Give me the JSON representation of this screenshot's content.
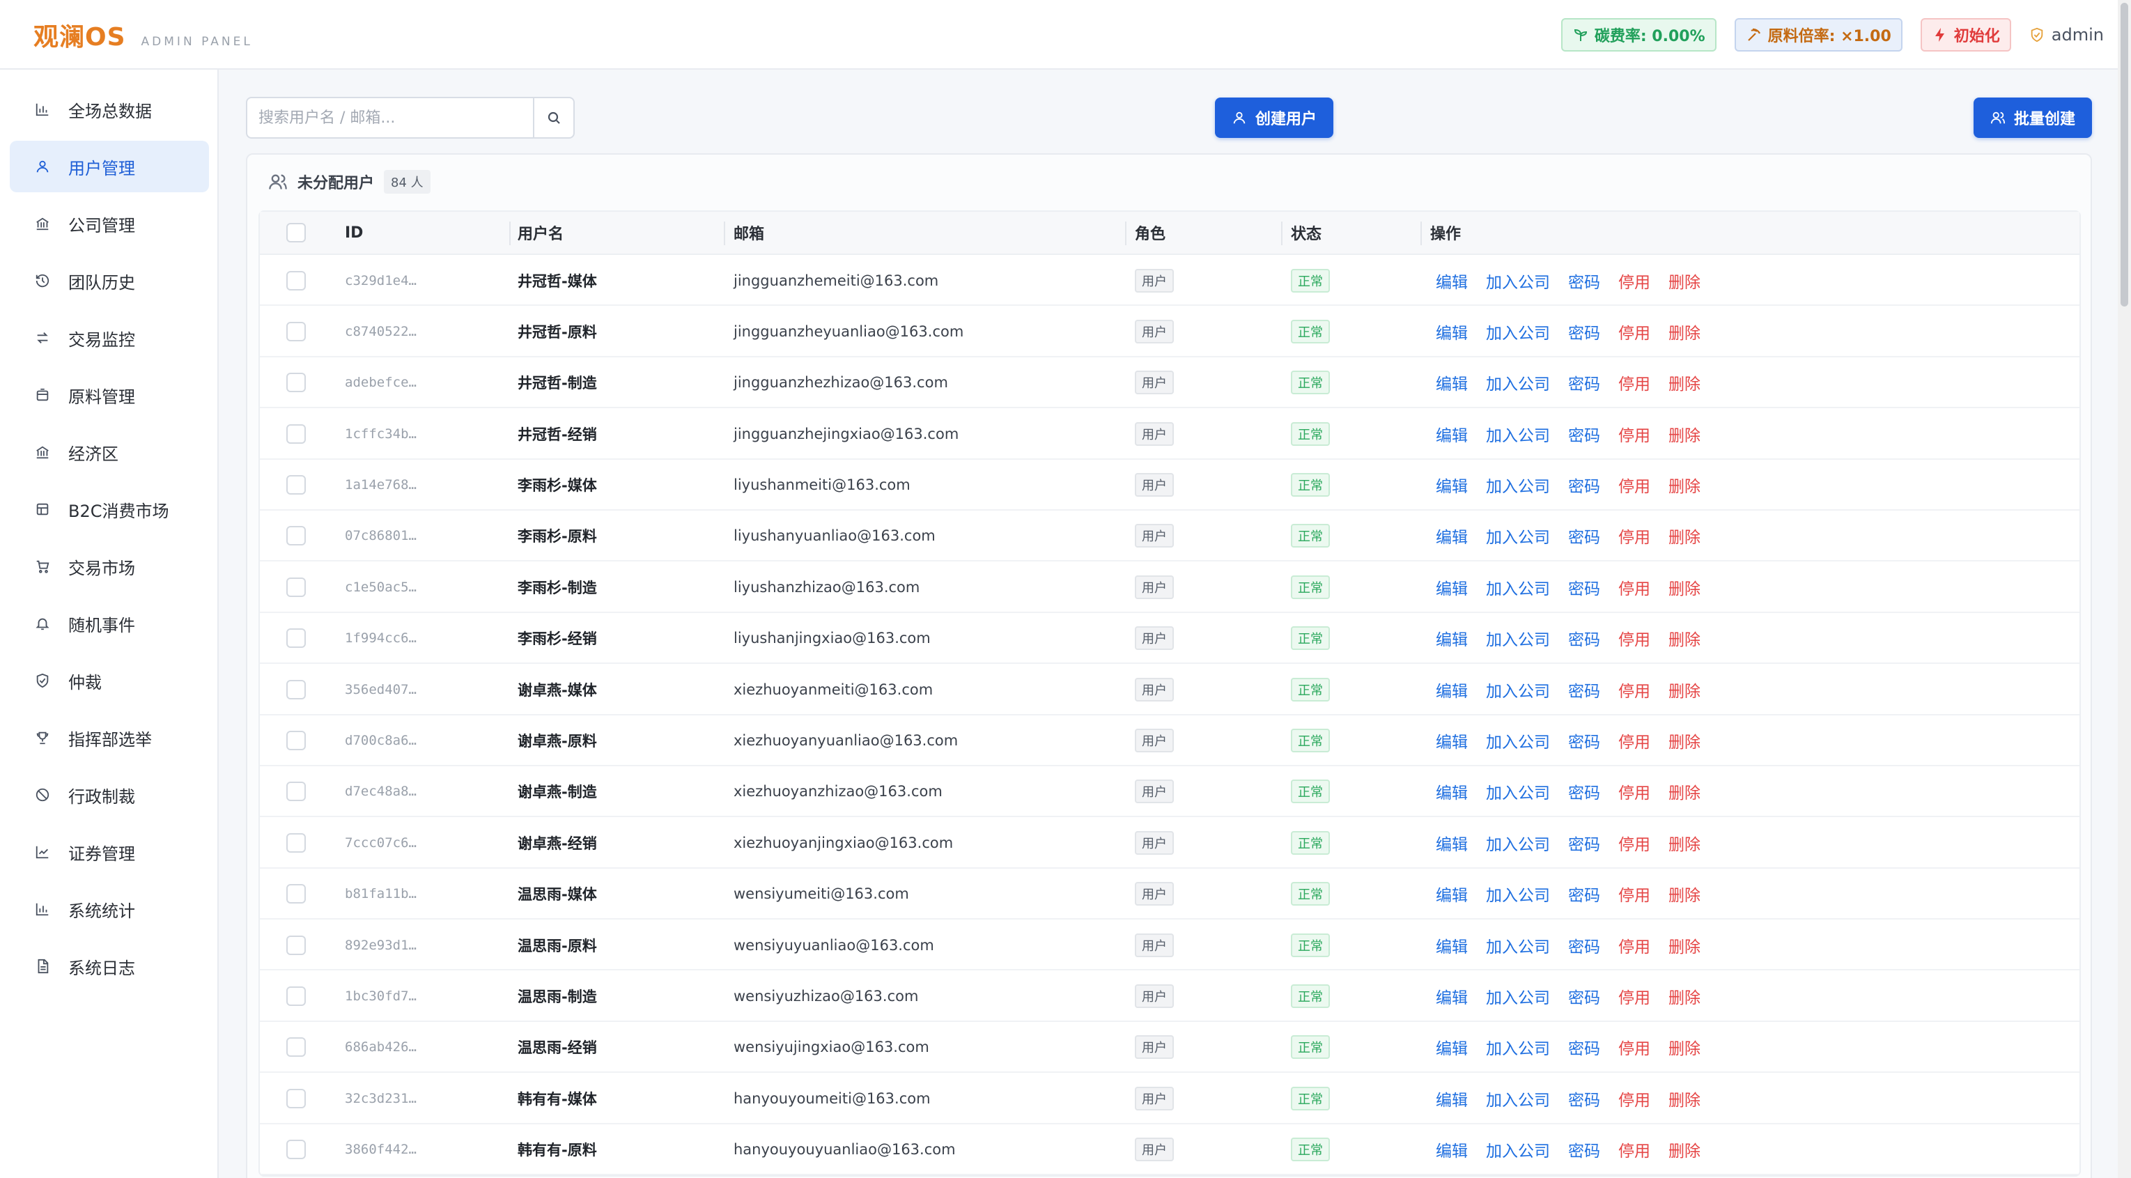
{
  "header": {
    "brand": "观澜OS",
    "subtitle": "ADMIN PANEL",
    "carbon": "碳费率: 0.00%",
    "material": "原料倍率: ×1.00",
    "init": "初始化",
    "user": "admin"
  },
  "colors": {
    "accent": "#1e5fdc",
    "brand": "#e67e22",
    "danger": "#e54545",
    "success": "#2aa85c"
  },
  "sidebar": {
    "items": [
      {
        "label": "全场总数据",
        "icon": "bar-chart-icon"
      },
      {
        "label": "用户管理",
        "icon": "user-icon",
        "active": true
      },
      {
        "label": "公司管理",
        "icon": "bank-icon"
      },
      {
        "label": "团队历史",
        "icon": "history-icon"
      },
      {
        "label": "交易监控",
        "icon": "exchange-icon"
      },
      {
        "label": "原料管理",
        "icon": "box-icon"
      },
      {
        "label": "经济区",
        "icon": "bank-icon"
      },
      {
        "label": "B2C消费市场",
        "icon": "shop-icon"
      },
      {
        "label": "交易市场",
        "icon": "cart-icon"
      },
      {
        "label": "随机事件",
        "icon": "bell-icon"
      },
      {
        "label": "仲裁",
        "icon": "shield-icon"
      },
      {
        "label": "指挥部选举",
        "icon": "trophy-icon"
      },
      {
        "label": "行政制裁",
        "icon": "ban-icon"
      },
      {
        "label": "证券管理",
        "icon": "line-chart-icon"
      },
      {
        "label": "系统统计",
        "icon": "bar-chart-icon"
      },
      {
        "label": "系统日志",
        "icon": "file-icon"
      }
    ]
  },
  "toolbar": {
    "search_placeholder": "搜索用户名 / 邮箱...",
    "create_label": "创建用户",
    "batch_label": "批量创建"
  },
  "panel": {
    "title": "未分配用户",
    "count": "84 人"
  },
  "table": {
    "columns": [
      "ID",
      "用户名",
      "邮箱",
      "角色",
      "状态",
      "操作"
    ],
    "actions": [
      "编辑",
      "加入公司",
      "密码",
      "停用",
      "删除"
    ],
    "rows": [
      {
        "id": "c329d1e4…",
        "username": "井冠哲-媒体",
        "email": "jingguanzhemeiti@163.com",
        "role": "用户",
        "status": "正常"
      },
      {
        "id": "c8740522…",
        "username": "井冠哲-原料",
        "email": "jingguanzheyuanliao@163.com",
        "role": "用户",
        "status": "正常"
      },
      {
        "id": "adebefce…",
        "username": "井冠哲-制造",
        "email": "jingguanzhezhizao@163.com",
        "role": "用户",
        "status": "正常"
      },
      {
        "id": "1cffc34b…",
        "username": "井冠哲-经销",
        "email": "jingguanzhejingxiao@163.com",
        "role": "用户",
        "status": "正常"
      },
      {
        "id": "1a14e768…",
        "username": "李雨杉-媒体",
        "email": "liyushanmeiti@163.com",
        "role": "用户",
        "status": "正常"
      },
      {
        "id": "07c86801…",
        "username": "李雨杉-原料",
        "email": "liyushanyuanliao@163.com",
        "role": "用户",
        "status": "正常"
      },
      {
        "id": "c1e50ac5…",
        "username": "李雨杉-制造",
        "email": "liyushanzhizao@163.com",
        "role": "用户",
        "status": "正常"
      },
      {
        "id": "1f994cc6…",
        "username": "李雨杉-经销",
        "email": "liyushanjingxiao@163.com",
        "role": "用户",
        "status": "正常"
      },
      {
        "id": "356ed407…",
        "username": "谢卓燕-媒体",
        "email": "xiezhuoyanmeiti@163.com",
        "role": "用户",
        "status": "正常"
      },
      {
        "id": "d700c8a6…",
        "username": "谢卓燕-原料",
        "email": "xiezhuoyanyuanliao@163.com",
        "role": "用户",
        "status": "正常"
      },
      {
        "id": "d7ec48a8…",
        "username": "谢卓燕-制造",
        "email": "xiezhuoyanzhizao@163.com",
        "role": "用户",
        "status": "正常"
      },
      {
        "id": "7ccc07c6…",
        "username": "谢卓燕-经销",
        "email": "xiezhuoyanjingxiao@163.com",
        "role": "用户",
        "status": "正常"
      },
      {
        "id": "b81fa11b…",
        "username": "温思雨-媒体",
        "email": "wensiyumeiti@163.com",
        "role": "用户",
        "status": "正常"
      },
      {
        "id": "892e93d1…",
        "username": "温思雨-原料",
        "email": "wensiyuyuanliao@163.com",
        "role": "用户",
        "status": "正常"
      },
      {
        "id": "1bc30fd7…",
        "username": "温思雨-制造",
        "email": "wensiyuzhizao@163.com",
        "role": "用户",
        "status": "正常"
      },
      {
        "id": "686ab426…",
        "username": "温思雨-经销",
        "email": "wensiyujingxiao@163.com",
        "role": "用户",
        "status": "正常"
      },
      {
        "id": "32c3d231…",
        "username": "韩有有-媒体",
        "email": "hanyouyoumeiti@163.com",
        "role": "用户",
        "status": "正常"
      },
      {
        "id": "3860f442…",
        "username": "韩有有-原料",
        "email": "hanyouyouyuanliao@163.com",
        "role": "用户",
        "status": "正常"
      }
    ]
  }
}
